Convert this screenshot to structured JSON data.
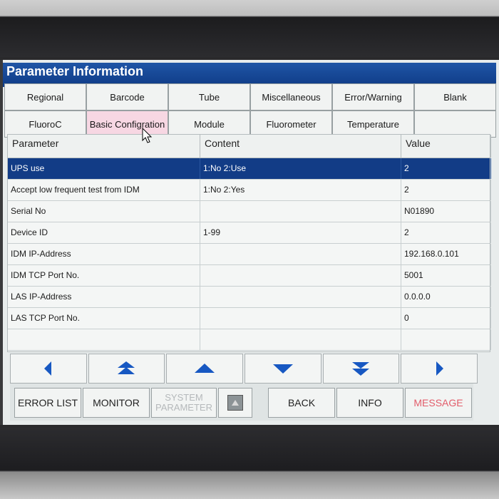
{
  "window": {
    "title": "Parameter Information"
  },
  "tabs": [
    {
      "label": "Regional"
    },
    {
      "label": "Barcode"
    },
    {
      "label": "Tube"
    },
    {
      "label": "Miscellaneous"
    },
    {
      "label": "Error/Warning"
    },
    {
      "label": "Blank"
    },
    {
      "label": "FluoroC"
    },
    {
      "label": "Basic Configration",
      "active": true
    },
    {
      "label": "Module"
    },
    {
      "label": "Fluorometer"
    },
    {
      "label": "Temperature"
    },
    {
      "label": ""
    }
  ],
  "table": {
    "headers": [
      "Parameter",
      "Content",
      "Value"
    ],
    "rows": [
      {
        "parameter": "UPS use",
        "content": "1:No 2:Use",
        "value": "2",
        "selected": true
      },
      {
        "parameter": "Accept low frequent test from IDM",
        "content": "1:No 2:Yes",
        "value": "2"
      },
      {
        "parameter": "Serial No",
        "content": "",
        "value": "N01890"
      },
      {
        "parameter": "Device ID",
        "content": "1-99",
        "value": "2"
      },
      {
        "parameter": "IDM IP-Address",
        "content": "",
        "value": "192.168.0.101"
      },
      {
        "parameter": "IDM TCP Port No.",
        "content": "",
        "value": "5001"
      },
      {
        "parameter": "LAS IP-Address",
        "content": "",
        "value": "0.0.0.0"
      },
      {
        "parameter": "LAS TCP Port No.",
        "content": "",
        "value": "0"
      },
      {
        "parameter": "",
        "content": "",
        "value": ""
      }
    ]
  },
  "navigation": {
    "color": "#1758c2",
    "buttons": [
      "arrow-left-icon",
      "page-up-icon",
      "arrow-up-icon",
      "arrow-down-icon",
      "page-down-icon",
      "arrow-right-icon"
    ]
  },
  "bottom": {
    "error_list": "ERROR LIST",
    "monitor": "MONITOR",
    "system_parameter_line1": "SYSTEM",
    "system_parameter_line2": "PARAMETER",
    "back": "BACK",
    "info": "INFO",
    "message": "MESSAGE"
  }
}
